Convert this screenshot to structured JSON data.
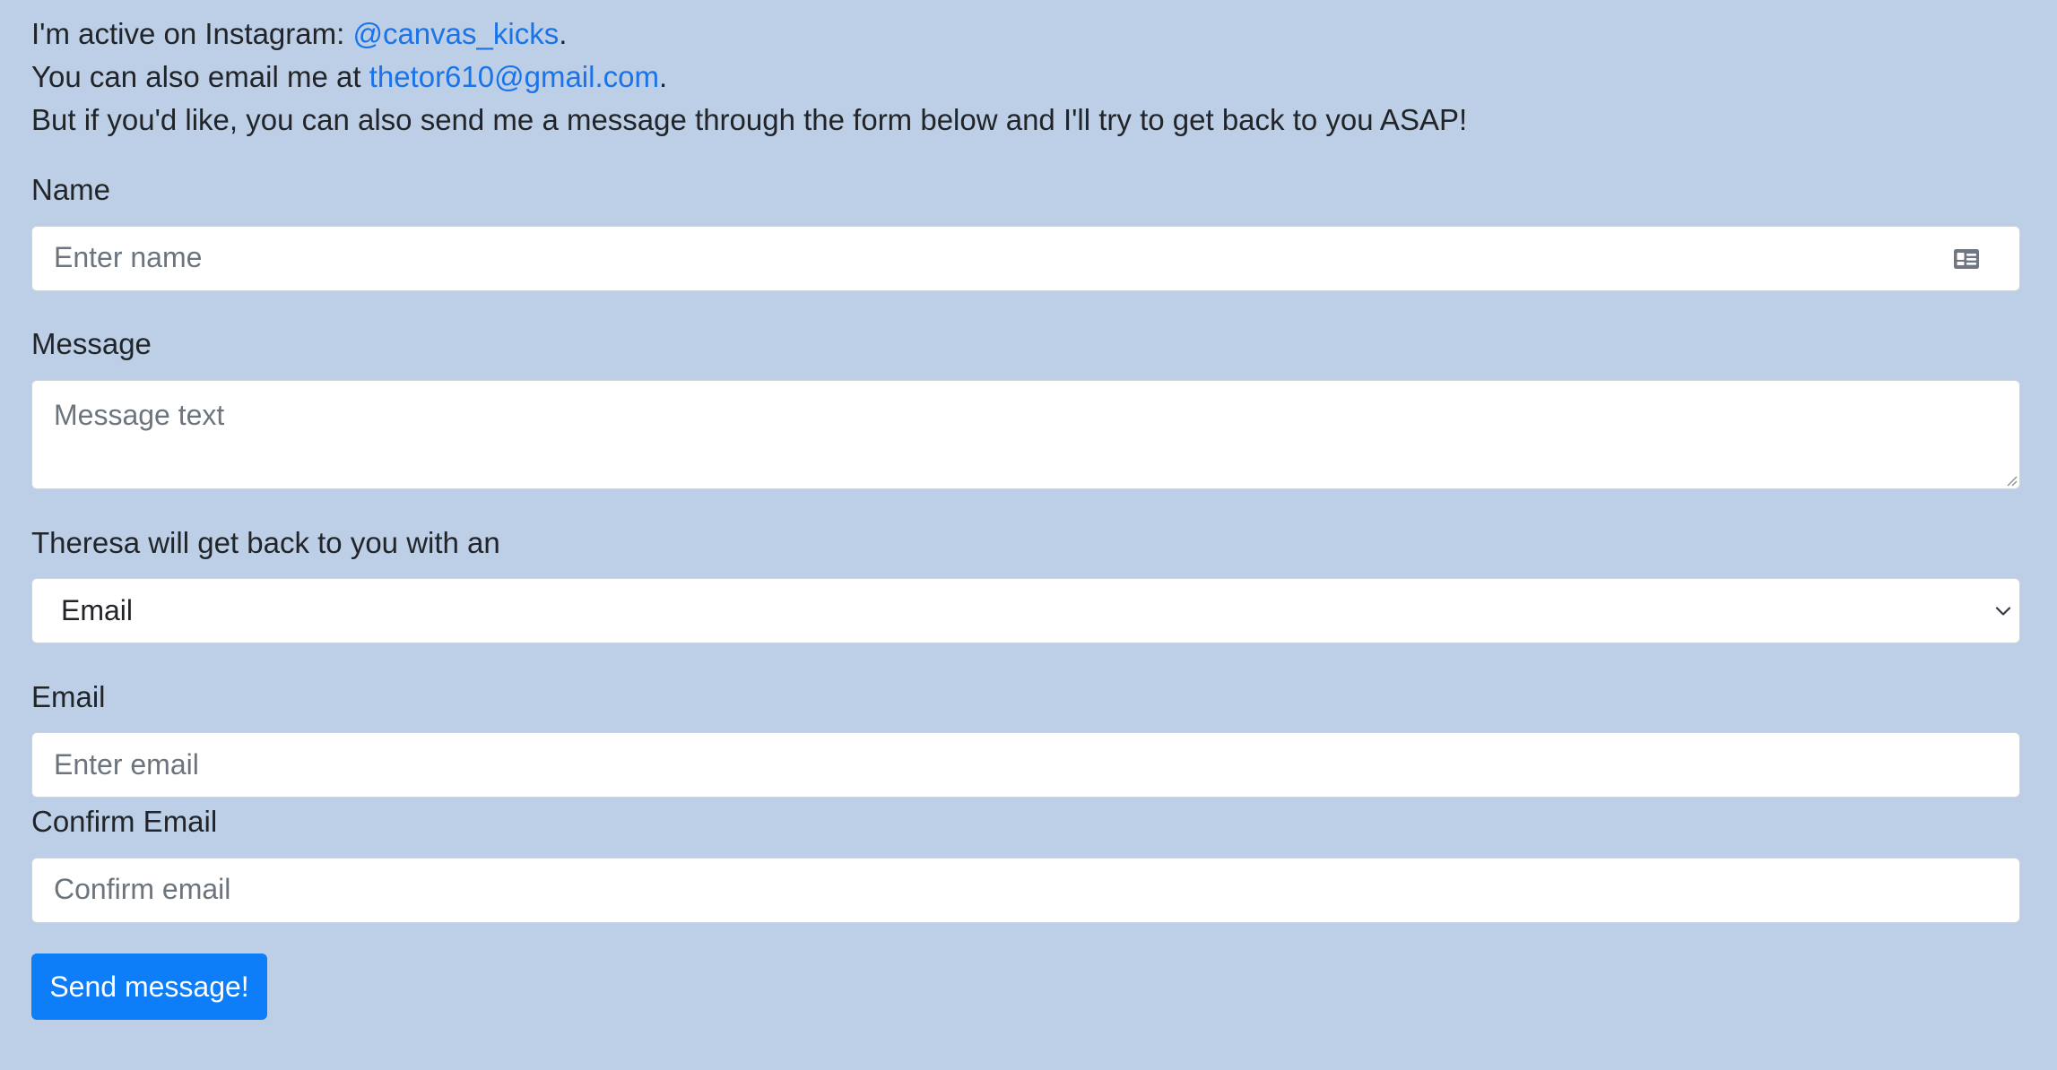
{
  "intro": {
    "instagram_prefix": "I'm active on Instagram: ",
    "instagram_handle": "@canvas_kicks",
    "instagram_suffix": ".",
    "email_prefix": "You can also email me at ",
    "email_address": "thetor610@gmail.com",
    "email_suffix": ".",
    "form_note": "But if you'd like, you can also send me a message through the form below and I'll try to get back to you ASAP!"
  },
  "form": {
    "name": {
      "label": "Name",
      "placeholder": "Enter name",
      "icon": "id-card-icon"
    },
    "message": {
      "label": "Message",
      "placeholder": "Message text"
    },
    "reply_method": {
      "label": "Theresa will get back to you with an",
      "selected": "Email",
      "icon": "chevron-down-icon"
    },
    "email": {
      "label": "Email",
      "placeholder": "Enter email"
    },
    "confirm_email": {
      "label": "Confirm Email",
      "placeholder": "Confirm email"
    },
    "submit_label": "Send message!"
  },
  "colors": {
    "page_background": "#bdcfe6",
    "link": "#1a73e8",
    "button": "#0d7df8"
  }
}
